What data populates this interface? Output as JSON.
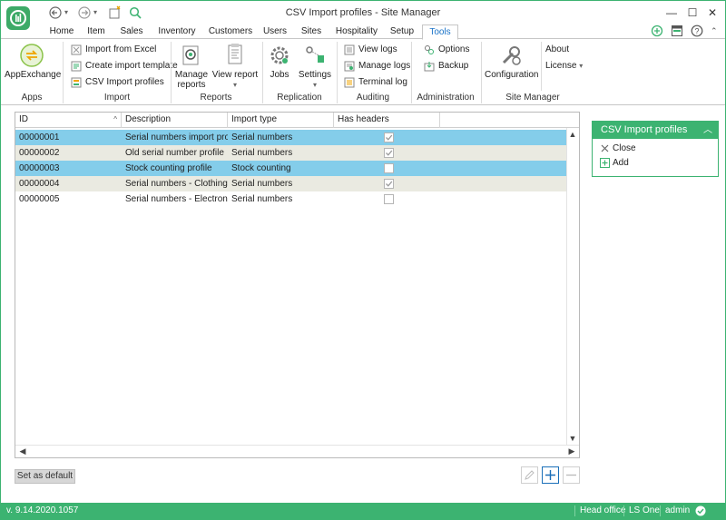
{
  "window": {
    "title": "CSV Import profiles - Site Manager"
  },
  "tabs": [
    "Home",
    "Item",
    "Sales",
    "Inventory",
    "Customers",
    "Users",
    "Sites",
    "Hospitality",
    "Setup",
    "Tools"
  ],
  "ribbon": {
    "apps": {
      "appexchange": "AppExchange",
      "group": "Apps"
    },
    "import": {
      "from_excel": "Import from Excel",
      "create_template": "Create import template",
      "csv_profiles": "CSV Import profiles",
      "group": "Import"
    },
    "reports": {
      "manage_l1": "Manage",
      "manage_l2": "reports",
      "view_report": "View report",
      "group": "Reports"
    },
    "replication": {
      "jobs": "Jobs",
      "settings": "Settings",
      "group": "Replication"
    },
    "auditing": {
      "view_logs": "View logs",
      "manage_logs": "Manage logs",
      "terminal_log": "Terminal log",
      "group": "Auditing"
    },
    "administration": {
      "options": "Options",
      "backup": "Backup",
      "group": "Administration"
    },
    "site_manager": {
      "configuration": "Configuration",
      "about": "About",
      "license": "License",
      "group": "Site Manager"
    }
  },
  "grid": {
    "columns": [
      "ID",
      "Description",
      "Import type",
      "Has headers"
    ],
    "rows": [
      {
        "id": "00000001",
        "description": "Serial numbers import profile",
        "type": "Serial numbers",
        "headers": true
      },
      {
        "id": "00000002",
        "description": "Old serial number profile",
        "type": "Serial numbers",
        "headers": true
      },
      {
        "id": "00000003",
        "description": "Stock counting profile",
        "type": "Stock counting",
        "headers": false
      },
      {
        "id": "00000004",
        "description": "Serial numbers - Clothing",
        "type": "Serial numbers",
        "headers": true
      },
      {
        "id": "00000005",
        "description": "Serial numbers - Electronics",
        "type": "Serial numbers",
        "headers": false
      }
    ]
  },
  "buttons": {
    "set_default": "Set as default"
  },
  "panel": {
    "title": "CSV Import profiles",
    "close": "Close",
    "add": "Add"
  },
  "status": {
    "version": "v. 9.14.2020.1057",
    "office": "Head office",
    "product": "LS One",
    "user": "admin"
  },
  "colors": {
    "brand": "#3cb371",
    "selected_row": "#84cdea",
    "alt_row": "#eaeae1",
    "active_tab": "#1a73c8"
  }
}
